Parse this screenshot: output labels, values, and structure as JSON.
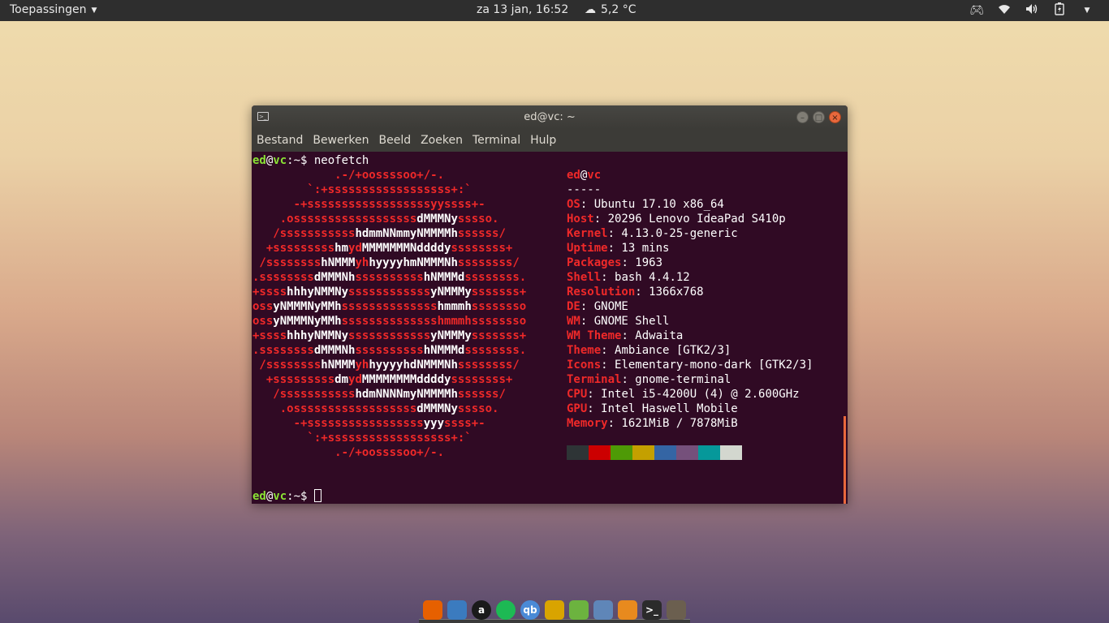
{
  "topbar": {
    "apps_label": "Toepassingen",
    "clock": "za 13 jan, 16:52",
    "weather_icon": "cloud-icon",
    "weather_temp": "5,2 °C",
    "tray_icons": [
      "game-controller-icon",
      "wifi-icon",
      "volume-icon",
      "battery-charging-icon",
      "chevron-down-icon"
    ]
  },
  "window": {
    "title": "ed@vc: ~",
    "menu": [
      "Bestand",
      "Bewerken",
      "Beeld",
      "Zoeken",
      "Terminal",
      "Hulp"
    ]
  },
  "terminal": {
    "prompt_user": "ed",
    "prompt_at": "@",
    "prompt_host": "vc",
    "prompt_path": ":~",
    "prompt_symbol": "$ ",
    "command": "neofetch",
    "logo": [
      [
        [
          "r",
          "            .-/+oossssoo+/-."
        ]
      ],
      [
        [
          "r",
          "        `:+ssssssssssssssssss+:`"
        ]
      ],
      [
        [
          "r",
          "      -+ssssssssssssssssssyyssss+-"
        ]
      ],
      [
        [
          "r",
          "    .ossssssssssssssssss"
        ],
        [
          "w",
          "dMMMNy"
        ],
        [
          "r",
          "sssso."
        ]
      ],
      [
        [
          "r",
          "   /sssssssssss"
        ],
        [
          "w",
          "hdmmNNmmyNMMMMh"
        ],
        [
          "r",
          "ssssss/"
        ]
      ],
      [
        [
          "r",
          "  +sssssssss"
        ],
        [
          "w",
          "hm"
        ],
        [
          "r",
          "yd"
        ],
        [
          "w",
          "MMMMMMMNddddy"
        ],
        [
          "r",
          "ssssssss+"
        ]
      ],
      [
        [
          "r",
          " /ssssssss"
        ],
        [
          "w",
          "hNMMM"
        ],
        [
          "r",
          "yh"
        ],
        [
          "w",
          "hyyyyhmNMMMNh"
        ],
        [
          "r",
          "ssssssss/"
        ]
      ],
      [
        [
          "r",
          ".ssssssss"
        ],
        [
          "w",
          "dMMMNh"
        ],
        [
          "r",
          "ssssssssss"
        ],
        [
          "w",
          "hNMMMd"
        ],
        [
          "r",
          "ssssssss."
        ]
      ],
      [
        [
          "r",
          "+ssss"
        ],
        [
          "w",
          "hhhyNMMNy"
        ],
        [
          "r",
          "ssssssssssss"
        ],
        [
          "w",
          "yNMMMy"
        ],
        [
          "r",
          "sssssss+"
        ]
      ],
      [
        [
          "r",
          "oss"
        ],
        [
          "w",
          "yNMMMNyMMh"
        ],
        [
          "r",
          "ssssssssssssss"
        ],
        [
          "w",
          "hmmmh"
        ],
        [
          "r",
          "ssssssso"
        ]
      ],
      [
        [
          "r",
          "oss"
        ],
        [
          "w",
          "yNMMMNyMMh"
        ],
        [
          "r",
          "sssssssssssssshmmmhssssssso"
        ]
      ],
      [
        [
          "r",
          "+ssss"
        ],
        [
          "w",
          "hhhyNMMNy"
        ],
        [
          "r",
          "ssssssssssss"
        ],
        [
          "w",
          "yNMMMy"
        ],
        [
          "r",
          "sssssss+"
        ]
      ],
      [
        [
          "r",
          ".ssssssss"
        ],
        [
          "w",
          "dMMMNh"
        ],
        [
          "r",
          "ssssssssss"
        ],
        [
          "w",
          "hNMMMd"
        ],
        [
          "r",
          "ssssssss."
        ]
      ],
      [
        [
          "r",
          " /ssssssss"
        ],
        [
          "w",
          "hNMMM"
        ],
        [
          "r",
          "yh"
        ],
        [
          "w",
          "hyyyyhdNMMMNh"
        ],
        [
          "r",
          "ssssssss/"
        ]
      ],
      [
        [
          "r",
          "  +sssssssss"
        ],
        [
          "w",
          "dm"
        ],
        [
          "r",
          "yd"
        ],
        [
          "w",
          "MMMMMMMMddddy"
        ],
        [
          "r",
          "ssssssss+"
        ]
      ],
      [
        [
          "r",
          "   /sssssssssss"
        ],
        [
          "w",
          "hdmNNNNmyNMMMMh"
        ],
        [
          "r",
          "ssssss/"
        ]
      ],
      [
        [
          "r",
          "    .ossssssssssssssssss"
        ],
        [
          "w",
          "dMMMNy"
        ],
        [
          "r",
          "sssso."
        ]
      ],
      [
        [
          "r",
          "      -+sssssssssssssssss"
        ],
        [
          "w",
          "yyy"
        ],
        [
          "r",
          "ssss+-"
        ]
      ],
      [
        [
          "r",
          "        `:+ssssssssssssssssss+:`"
        ]
      ],
      [
        [
          "r",
          "            .-/+oossssoo+/-."
        ]
      ]
    ],
    "info_user": "ed",
    "info_at": "@",
    "info_host": "vc",
    "separator": "-----",
    "info": [
      {
        "key": "OS",
        "value": ": Ubuntu 17.10 x86_64"
      },
      {
        "key": "Host",
        "value": ": 20296 Lenovo IdeaPad S410p"
      },
      {
        "key": "Kernel",
        "value": ": 4.13.0-25-generic"
      },
      {
        "key": "Uptime",
        "value": ": 13 mins"
      },
      {
        "key": "Packages",
        "value": ": 1963"
      },
      {
        "key": "Shell",
        "value": ": bash 4.4.12"
      },
      {
        "key": "Resolution",
        "value": ": 1366x768"
      },
      {
        "key": "DE",
        "value": ": GNOME"
      },
      {
        "key": "WM",
        "value": ": GNOME Shell"
      },
      {
        "key": "WM Theme",
        "value": ": Adwaita"
      },
      {
        "key": "Theme",
        "value": ": Ambiance [GTK2/3]"
      },
      {
        "key": "Icons",
        "value": ": Elementary-mono-dark [GTK2/3]"
      },
      {
        "key": "Terminal",
        "value": ": gnome-terminal"
      },
      {
        "key": "CPU",
        "value": ": Intel i5-4200U (4) @ 2.600GHz"
      },
      {
        "key": "GPU",
        "value": ": Intel Haswell Mobile"
      },
      {
        "key": "Memory",
        "value": ": 1621MiB / 7878MiB"
      }
    ],
    "palette": [
      "#2e3436",
      "#cc0000",
      "#4e9a06",
      "#c4a000",
      "#3465a4",
      "#75507b",
      "#06989a",
      "#d3d7cf"
    ]
  },
  "dock": [
    {
      "name": "firefox-icon",
      "glyph": "",
      "color": "#e66000"
    },
    {
      "name": "thunderbird-icon",
      "glyph": "",
      "color": "#3b7bbf"
    },
    {
      "name": "amazon-icon",
      "glyph": "a",
      "color": "#1a1a1a"
    },
    {
      "name": "spotify-icon",
      "glyph": "",
      "color": "#1db954"
    },
    {
      "name": "qbittorrent-icon",
      "glyph": "qb",
      "color": "#4a8ad6"
    },
    {
      "name": "puzzle-game-icon",
      "glyph": "",
      "color": "#d9a400"
    },
    {
      "name": "rss-reader-icon",
      "glyph": "",
      "color": "#6cb33f"
    },
    {
      "name": "file-cabinet-icon",
      "glyph": "",
      "color": "#5f86b8"
    },
    {
      "name": "settings-icon",
      "glyph": "",
      "color": "#e88a1e"
    },
    {
      "name": "terminal-icon",
      "glyph": ">_",
      "color": "#2b2b2b"
    },
    {
      "name": "gimp-icon",
      "glyph": "",
      "color": "#6b5f4f"
    }
  ]
}
